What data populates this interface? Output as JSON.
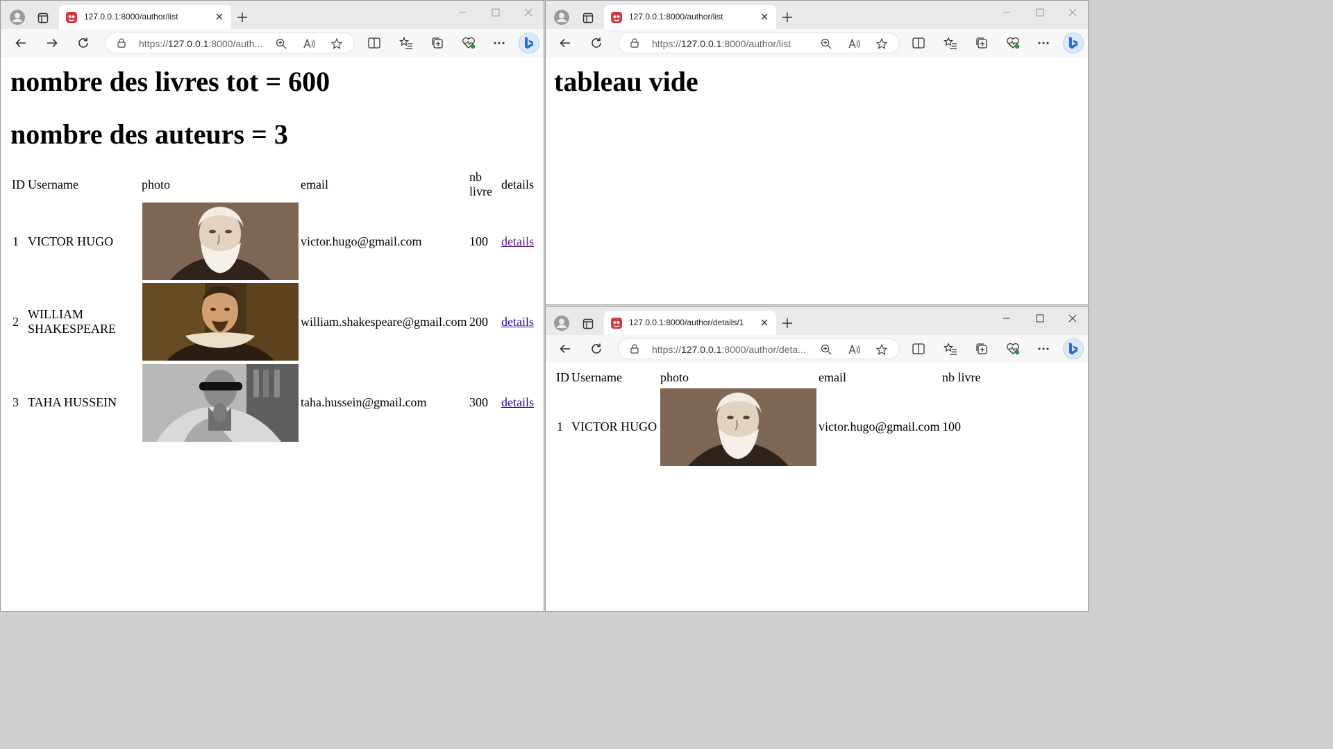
{
  "windows": {
    "left": {
      "tab_title": "127.0.0.1:8000/author/list",
      "url_prefix": "https://",
      "url_host": "127.0.0.1",
      "url_rest": ":8000/auth...",
      "heading_total_books": "nombre des livres tot = 600",
      "heading_total_authors": "nombre des auteurs = 3",
      "table": {
        "headers": {
          "id": "ID",
          "username": "Username",
          "photo": "photo",
          "email": "email",
          "nb_livre_line1": "nb",
          "nb_livre_line2": "livre",
          "details": "details"
        },
        "rows": [
          {
            "id": "1",
            "username_line1": "VICTOR HUGO",
            "email": "victor.hugo@gmail.com",
            "nb_livre": "100",
            "details": "details"
          },
          {
            "id": "2",
            "username_line1": "WILLIAM",
            "username_line2": "SHAKESPEARE",
            "email": "william.shakespeare@gmail.com",
            "nb_livre": "200",
            "details": "details"
          },
          {
            "id": "3",
            "username_line1": "TAHA HUSSEIN",
            "email": "taha.hussein@gmail.com",
            "nb_livre": "300",
            "details": "details"
          }
        ]
      }
    },
    "top_right": {
      "tab_title": "127.0.0.1:8000/author/list",
      "url_prefix": "https://",
      "url_host": "127.0.0.1",
      "url_rest": ":8000/author/list",
      "heading": "tableau vide"
    },
    "bottom_right": {
      "tab_title": "127.0.0.1:8000/author/details/1",
      "url_prefix": "https://",
      "url_host": "127.0.0.1",
      "url_rest": ":8000/author/deta...",
      "table": {
        "headers": {
          "id": "ID",
          "username": "Username",
          "photo": "photo",
          "email": "email",
          "nb_livre": "nb livre"
        },
        "row": {
          "id": "1",
          "username": "VICTOR HUGO",
          "email": "victor.hugo@gmail.com",
          "nb_livre": "100"
        }
      }
    }
  },
  "colors": {
    "link": "#1a0dab",
    "link_visited": "#551a8b",
    "favicon": "#d7383f",
    "tabbar": "#e9e9e9"
  }
}
